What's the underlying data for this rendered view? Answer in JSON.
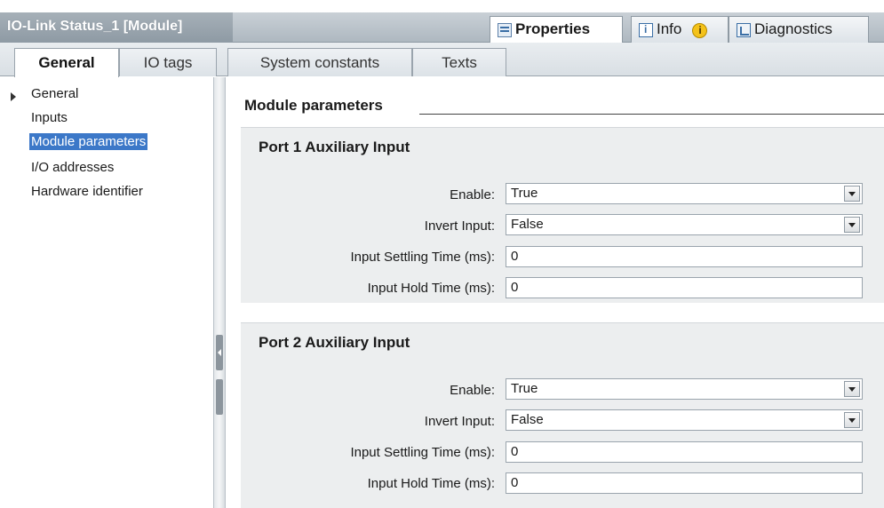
{
  "window": {
    "title": "IO-Link Status_1 [Module]"
  },
  "top_tabs": [
    {
      "label": "Properties",
      "icon": "properties-icon"
    },
    {
      "label": "Info",
      "icon": "info-icon"
    },
    {
      "label": "Diagnostics",
      "icon": "diagnostics-icon"
    }
  ],
  "tabs": [
    {
      "label": "General"
    },
    {
      "label": "IO tags"
    },
    {
      "label": "System constants"
    },
    {
      "label": "Texts"
    }
  ],
  "nav": {
    "items": [
      {
        "label": "General"
      },
      {
        "label": "Inputs"
      },
      {
        "label": "Module parameters"
      },
      {
        "label": "I/O addresses"
      },
      {
        "label": "Hardware identifier"
      }
    ]
  },
  "main": {
    "section_title": "Module parameters",
    "groups": [
      {
        "title": "Port 1 Auxiliary Input",
        "fields": [
          {
            "label": "Enable:",
            "value": "True"
          },
          {
            "label": "Invert Input:",
            "value": "False"
          },
          {
            "label": "Input Settling Time (ms):",
            "value": "0"
          },
          {
            "label": "Input Hold Time (ms):",
            "value": "0"
          }
        ]
      },
      {
        "title": "Port 2 Auxiliary Input",
        "fields": [
          {
            "label": "Enable:",
            "value": "True"
          },
          {
            "label": "Invert Input:",
            "value": "False"
          },
          {
            "label": "Input Settling Time (ms):",
            "value": "0"
          },
          {
            "label": "Input Hold Time (ms):",
            "value": "0"
          }
        ]
      }
    ]
  },
  "colors": {
    "selection": "#3c78c8",
    "panel": "#eceeef",
    "titlebar": "#aeb8c0"
  }
}
